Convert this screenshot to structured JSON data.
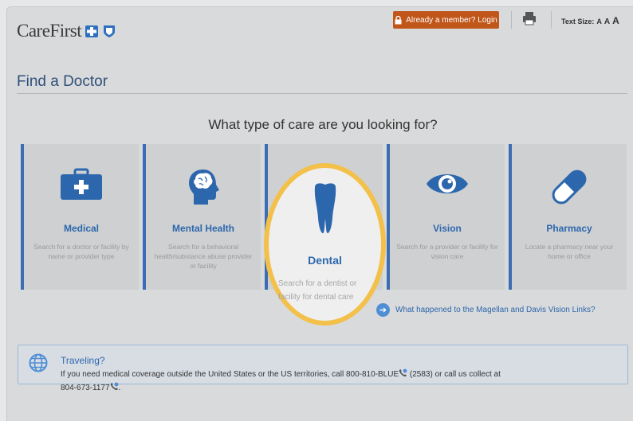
{
  "header": {
    "logo_text": "CareFirst",
    "login_label": "Already a member? Login",
    "text_size_label": "Text Size:",
    "text_size_options": [
      "A",
      "A",
      "A"
    ]
  },
  "page": {
    "title": "Find a Doctor",
    "question": "What type of care are you looking for?"
  },
  "cards": [
    {
      "name": "Medical",
      "desc": "Search for a doctor or facility by name or provider type",
      "icon": "medical-kit-icon"
    },
    {
      "name": "Mental Health",
      "desc": "Search for a behavioral health/substance abuse provider or facility",
      "icon": "head-brain-icon"
    },
    {
      "name": "Dental",
      "desc_line1": "Search for a dentist or",
      "desc_line2": "facility for dental care",
      "icon": "tooth-icon"
    },
    {
      "name": "Vision",
      "desc": "Search for a provider or facility for vision care",
      "icon": "eye-icon"
    },
    {
      "name": "Pharmacy",
      "desc": "Locate a pharmacy near your home or office",
      "icon": "pill-icon"
    }
  ],
  "magellan_link": "What happened to the Magellan and Davis Vision Links?",
  "travel": {
    "title": "Traveling?",
    "body_part1": "If you need medical coverage outside the United States or the US territories, call 800-810-BLUE",
    "body_part2": "(2583) or call us collect at",
    "body_part3": "804-673-1177",
    "body_part4": "."
  },
  "colors": {
    "accent_blue": "#2c67ad",
    "login_orange": "#c0561a",
    "highlight_yellow": "#f3c04a"
  }
}
